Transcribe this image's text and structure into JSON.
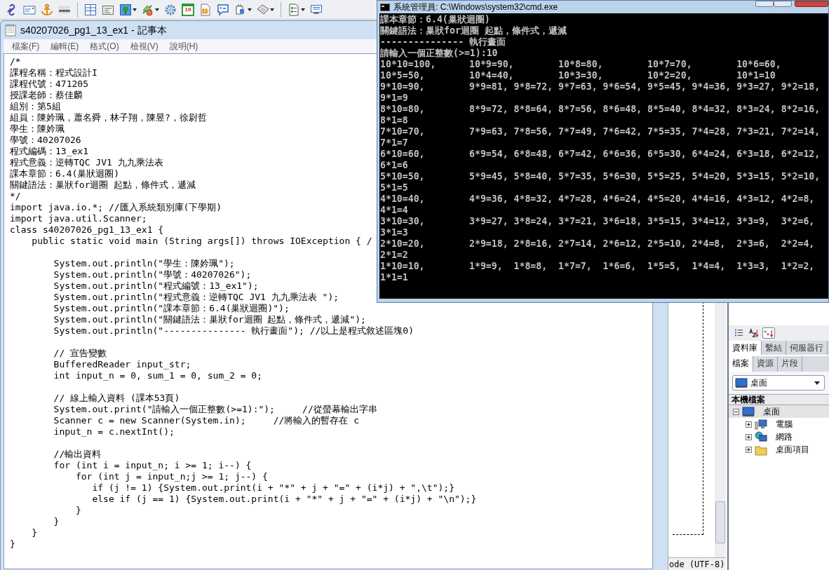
{
  "ide_toolbar": {
    "items": [
      {
        "kind": "link"
      },
      {
        "kind": "email"
      },
      {
        "kind": "anchor"
      },
      {
        "kind": "rule"
      },
      {
        "kind": "separator"
      },
      {
        "kind": "table"
      },
      {
        "kind": "form"
      },
      {
        "kind": "image",
        "dropdown": true
      },
      {
        "kind": "shapes",
        "dropdown": true
      },
      {
        "kind": "gear"
      },
      {
        "kind": "calendar",
        "label": "19"
      },
      {
        "kind": "hash"
      },
      {
        "kind": "comment"
      },
      {
        "kind": "plugin",
        "dropdown": true
      },
      {
        "kind": "tag",
        "dropdown": true
      },
      {
        "kind": "separator"
      },
      {
        "kind": "template",
        "dropdown": true
      },
      {
        "kind": "monitor"
      }
    ]
  },
  "notepad": {
    "title": "s40207026_pg1_13_ex1 - 記事本",
    "menu": [
      "檔案(F)",
      "編輯(E)",
      "格式(O)",
      "檢視(V)",
      "說明(H)"
    ],
    "code_blocks": [
      [
        "/*",
        "課程名稱：程式設計I",
        "課程代號：471205",
        "授課老師：蔡佳麟",
        "組別：第5組",
        "組員：陳妗珮，蕭名舜，林子翔，陳昱?，徐尉哲",
        "學生：陳妗珮",
        "學號：40207026",
        "程式編碼：13_ex1",
        "程式意義：逆轉TQC JV1 九九乘法表",
        "課本章節：6.4(巢狀迴圈)",
        "關鍵語法：巢狀for迴圈 起點，條件式，遞減",
        "*/",
        "import java.io.*; //匯入系統類別庫(下學期)",
        "import java.util.Scanner;",
        "class s40207026_pg1_13_ex1 {",
        "    public static void main (String args[]) throws IOException { /"
      ],
      [
        "        System.out.println(\"學生：陳妗珮\");",
        "        System.out.println(\"學號：40207026\");",
        "        System.out.println(\"程式編號：13_ex1\");",
        "        System.out.println(\"程式意義：逆轉TQC JV1 九九乘法表 \");",
        "        System.out.println(\"課本章節：6.4(巢狀迴圈)\");",
        "        System.out.println(\"關鍵語法：巢狀for迴圈 起點，條件式，遞減\");",
        "        System.out.println(\"--------------- 執行畫面\"); //以上是程式敘述區塊0)"
      ],
      [
        "        // 宣告變數",
        "        BufferedReader input_str;",
        "        int input_n = 0, sum_1 = 0, sum_2 = 0;"
      ],
      [
        "        // 線上輸入資料 (課本53頁)",
        "        System.out.print(\"請輸入一個正整數(>=1):\");     //從螢幕輸出字串",
        "        Scanner c = new Scanner(System.in);     //將輸入的暫存在 c",
        "        input_n = c.nextInt();"
      ],
      [
        "        //輸出資料",
        "        for (int i = input_n; i >= 1; i--) {",
        "            for (int j = input_n;j >= 1; j--) {",
        "               if (j != 1) {System.out.print(i + \"*\" + j + \"=\" + (i*j) + \",\\t\");}",
        "               else if (j == 1) {System.out.print(i + \"*\" + j + \"=\" + (i*j) + \"\\n\");}",
        "            }",
        "        }",
        "    }",
        "}"
      ]
    ]
  },
  "console": {
    "title": "系統管理員: C:\\Windows\\system32\\cmd.exe",
    "lines": [
      "課本章節：6.4(巢狀迴圈)",
      "關鍵語法：巢狀for迴圈 起點，條件式，遞減",
      "--------------- 執行畫面",
      "請輸入一個正整數(>=1):10",
      "10*10=100,      10*9=90,        10*8=80,        10*7=70,        10*6=60,",
      "10*5=50,        10*4=40,        10*3=30,        10*2=20,        10*1=10",
      "9*10=90,        9*9=81, 9*8=72, 9*7=63, 9*6=54, 9*5=45, 9*4=36, 9*3=27, 9*2=18,",
      "9*1=9",
      "8*10=80,        8*9=72, 8*8=64, 8*7=56, 8*6=48, 8*5=40, 8*4=32, 8*3=24, 8*2=16,",
      "8*1=8",
      "7*10=70,        7*9=63, 7*8=56, 7*7=49, 7*6=42, 7*5=35, 7*4=28, 7*3=21, 7*2=14,",
      "7*1=7",
      "6*10=60,        6*9=54, 6*8=48, 6*7=42, 6*6=36, 6*5=30, 6*4=24, 6*3=18, 6*2=12,",
      "6*1=6",
      "5*10=50,        5*9=45, 5*8=40, 5*7=35, 5*6=30, 5*5=25, 5*4=20, 5*3=15, 5*2=10,",
      "5*1=5",
      "4*10=40,        4*9=36, 4*8=32, 4*7=28, 4*6=24, 4*5=20, 4*4=16, 4*3=12, 4*2=8,",
      "4*1=4",
      "3*10=30,        3*9=27, 3*8=24, 3*7=21, 3*6=18, 3*5=15, 3*4=12, 3*3=9,  3*2=6,",
      "3*1=3",
      "2*10=20,        2*9=18, 2*8=16, 2*7=14, 2*6=12, 2*5=10, 2*4=8,  2*3=6,  2*2=4,",
      "2*1=2",
      "1*10=10,        1*9=9,  1*8=8,  1*7=7,  1*6=6,  1*5=5,  1*4=4,  1*3=3,  1*2=2,",
      "1*1=1"
    ]
  },
  "editor": {
    "status": "ode (UTF-8)"
  },
  "side_panel": {
    "tool_icons": [
      {
        "kind": "list",
        "selected": false
      },
      {
        "kind": "sort_az",
        "selected": false
      },
      {
        "kind": "sort_custom",
        "selected": true
      }
    ],
    "tabs": [
      {
        "label": "資料庫",
        "selected": true
      },
      {
        "label": "繫結",
        "selected": false
      },
      {
        "label": "伺服器行",
        "selected": false
      }
    ],
    "subtabs": [
      {
        "label": "檔案",
        "selected": true
      },
      {
        "label": "資源",
        "selected": false
      },
      {
        "label": "片段",
        "selected": false
      }
    ],
    "location": "桌面",
    "section": "本機檔案",
    "tree": [
      {
        "label": "桌面",
        "kind": "desktop",
        "expanded": true,
        "selected": true,
        "children": [
          {
            "label": "電腦",
            "kind": "computer",
            "expanded": false,
            "selected": false
          },
          {
            "label": "網路",
            "kind": "network",
            "expanded": false,
            "selected": false
          },
          {
            "label": "桌面項目",
            "kind": "folder",
            "expanded": false,
            "selected": false
          }
        ]
      }
    ]
  }
}
